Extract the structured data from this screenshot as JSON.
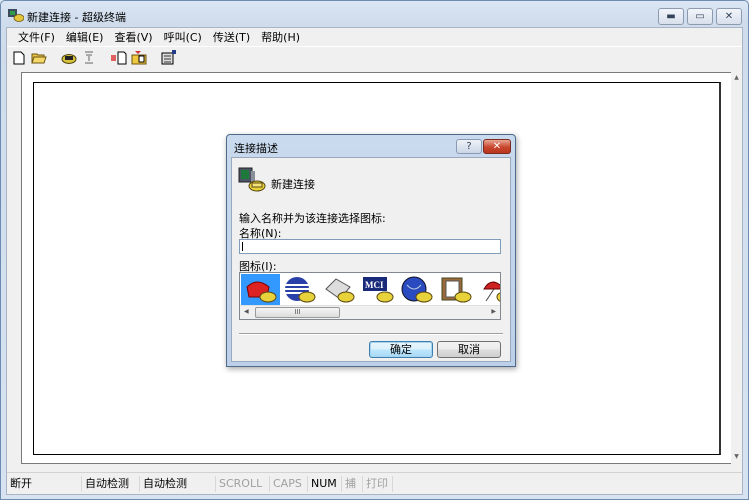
{
  "window": {
    "title": "新建连接 - 超级终端",
    "controls": [
      "minimize",
      "maximize",
      "close"
    ]
  },
  "menubar": [
    {
      "label": "文件(F)"
    },
    {
      "label": "编辑(E)"
    },
    {
      "label": "查看(V)"
    },
    {
      "label": "呼叫(C)"
    },
    {
      "label": "传送(T)"
    },
    {
      "label": "帮助(H)"
    }
  ],
  "toolbar": [
    {
      "icon": "new-document-icon"
    },
    {
      "icon": "open-folder-icon"
    },
    {
      "icon": "dial-phone-icon"
    },
    {
      "icon": "disconnect-icon",
      "disabled": true
    },
    {
      "icon": "send-file-icon"
    },
    {
      "icon": "receive-file-icon"
    },
    {
      "icon": "properties-icon"
    }
  ],
  "dialog": {
    "title": "连接描述",
    "help_label": "?",
    "close_label": "✕",
    "connection_name": "新建连接",
    "prompt": "输入名称并为该连接选择图标:",
    "name_label": "名称(N):",
    "name_value": "",
    "icon_label": "图标(I):",
    "icons": [
      {
        "name": "red-phone-icon",
        "selected": true
      },
      {
        "name": "globe-stripes-icon",
        "selected": false
      },
      {
        "name": "fax-machine-icon",
        "selected": false
      },
      {
        "name": "mci-logo-icon",
        "selected": false
      },
      {
        "name": "blue-globe-icon",
        "selected": false
      },
      {
        "name": "clipboard-documents-icon",
        "selected": false
      },
      {
        "name": "umbrella-icon",
        "selected": false
      }
    ],
    "scroll_thumb_label": "III",
    "ok_label": "确定",
    "cancel_label": "取消"
  },
  "statusbar": [
    {
      "label": "断开",
      "dim": false
    },
    {
      "label": "自动检测",
      "dim": false
    },
    {
      "label": "自动检测",
      "dim": false
    },
    {
      "label": "SCROLL",
      "dim": true
    },
    {
      "label": "CAPS",
      "dim": true
    },
    {
      "label": "NUM",
      "dim": false
    },
    {
      "label": "捕",
      "dim": true
    },
    {
      "label": "打印",
      "dim": true
    }
  ]
}
